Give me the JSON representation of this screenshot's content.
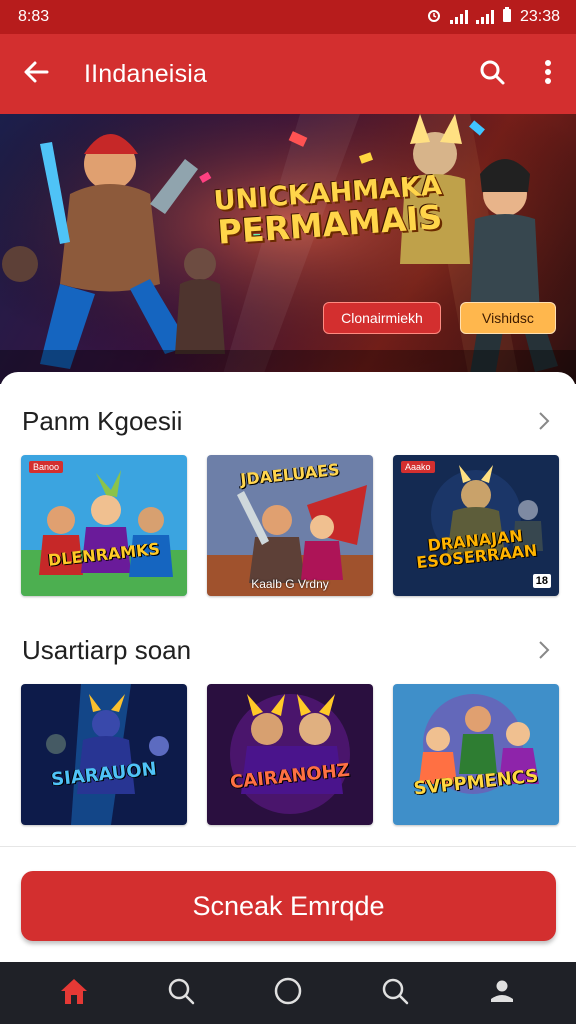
{
  "status_bar": {
    "time": "8:83",
    "right_time": "23:38"
  },
  "app_bar": {
    "title": "IIndaneisia",
    "back_icon": "arrow-left-icon",
    "search_icon": "search-icon",
    "menu_icon": "more-vert-icon"
  },
  "banner": {
    "title_line1": "UNICKAHMAKA",
    "title_line2": "PERMAMAIS",
    "primary_button": "Clonairmiekh",
    "secondary_button": "Vishidsc"
  },
  "sections": [
    {
      "title": "Panm Kgoesii",
      "cards": [
        {
          "title": "DLENRAMKS",
          "badge": "Banoo",
          "caption": "",
          "corner": "",
          "colors": [
            "#3ba4e0",
            "#4caf50"
          ]
        },
        {
          "title": "JDAELUAES",
          "badge": "",
          "caption": "Kaalb G Vrdny",
          "corner": "",
          "colors": [
            "#6d7fa8",
            "#a0522d"
          ]
        },
        {
          "title": "DRANAJAN ESOSERRAAN",
          "badge": "Aaako",
          "caption": "",
          "corner": "18",
          "colors": [
            "#142a52",
            "#0b1a33"
          ]
        }
      ]
    },
    {
      "title": "Usartiarp soan",
      "cards": [
        {
          "title": "SIARAUON",
          "badge": "",
          "caption": "",
          "corner": "",
          "colors": [
            "#0d1b4a",
            "#1e88e5"
          ]
        },
        {
          "title": "CAIRANOHZ",
          "badge": "",
          "caption": "",
          "corner": "",
          "colors": [
            "#2a0f3f",
            "#6a1b9a"
          ]
        },
        {
          "title": "SVPPMENCS",
          "badge": "",
          "caption": "",
          "corner": "",
          "colors": [
            "#3f8fc9",
            "#7b4fb0"
          ]
        }
      ]
    }
  ],
  "cta": {
    "label": "Scneak Emrqde"
  },
  "bottom_nav": {
    "items": [
      {
        "icon": "home-icon",
        "active": true
      },
      {
        "icon": "search-icon",
        "active": false
      },
      {
        "icon": "circle-icon",
        "active": false
      },
      {
        "icon": "search-icon",
        "active": false
      },
      {
        "icon": "profile-icon",
        "active": false
      }
    ]
  },
  "colors": {
    "primary": "#d32f2f",
    "status_bar": "#b71c1c",
    "accent": "#ffb74d",
    "nav_bg": "#1f2127"
  }
}
